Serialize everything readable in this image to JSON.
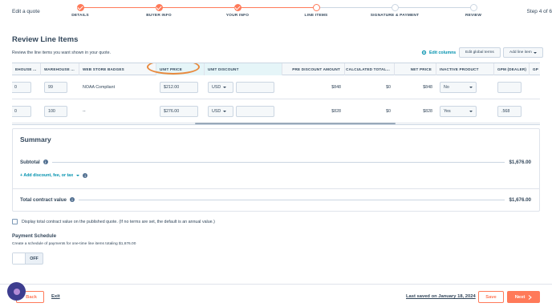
{
  "header": {
    "edit_quote": "Edit a quote",
    "step_of": "Step 4 of 6",
    "steps": [
      {
        "label": "DETAILS",
        "state": "done"
      },
      {
        "label": "BUYER INFO",
        "state": "done"
      },
      {
        "label": "YOUR INFO",
        "state": "done"
      },
      {
        "label": "LINE ITEMS",
        "state": "current"
      },
      {
        "label": "SIGNATURE & PAYMENT",
        "state": "todo"
      },
      {
        "label": "REVIEW",
        "state": "todo"
      }
    ]
  },
  "section": {
    "title": "Review Line Items",
    "subtitle": "Review the line items you want shown in your quote.",
    "edit_columns": "Edit columns",
    "edit_global_terms": "Edit global terms",
    "add_line_item": "Add line item"
  },
  "table": {
    "headers": [
      "EHOUSE ...",
      "WAREHOUSE ...",
      "WEB STORE BADGES",
      "UNIT PRICE",
      "UNIT DISCOUNT",
      "PRE DISCOUNT AMOUNT",
      "CALCULATED TOTAL...",
      "NET PRICE",
      "INACTIVE PRODUCT",
      "GPM (DEALER)",
      "GP"
    ],
    "rows": [
      {
        "ehouse": "0",
        "warehouse": "99",
        "badges": "NOAA Compliant",
        "unit_price": "$212.00",
        "discount_currency": "USD",
        "pre_discount": "$848",
        "calc_total": "$0",
        "net_price": "$848",
        "inactive": "No",
        "gpm": ""
      },
      {
        "ehouse": "0",
        "warehouse": "100",
        "badges": "--",
        "unit_price": "$276.00",
        "discount_currency": "USD",
        "pre_discount": "$828",
        "calc_total": "$0",
        "net_price": "$828",
        "inactive": "Yes",
        "gpm": ".568"
      }
    ]
  },
  "summary": {
    "title": "Summary",
    "subtitle_label": "Subtotal",
    "subtotal": "$1,676.00",
    "add_discount": "+ Add discount, fee, or tax",
    "total_label": "Total contract value",
    "total": "$1,676.00"
  },
  "options": {
    "display_total": "Display total contract value on the published quote. (If no terms are set, the default is an annual value.)",
    "payment_title": "Payment Schedule",
    "payment_sub": "Create a schedule of payments for one-time line items totaling $1,676.00",
    "toggle_label": "OFF"
  },
  "footer": {
    "back": "Back",
    "exit": "Exit",
    "last_saved": "Last saved on January 18, 2024",
    "save": "Save",
    "next": "Next"
  },
  "colors": {
    "accent": "#ff7a59",
    "link": "#0091ae",
    "text": "#33475b",
    "highlight_circle": "#e8893c"
  }
}
